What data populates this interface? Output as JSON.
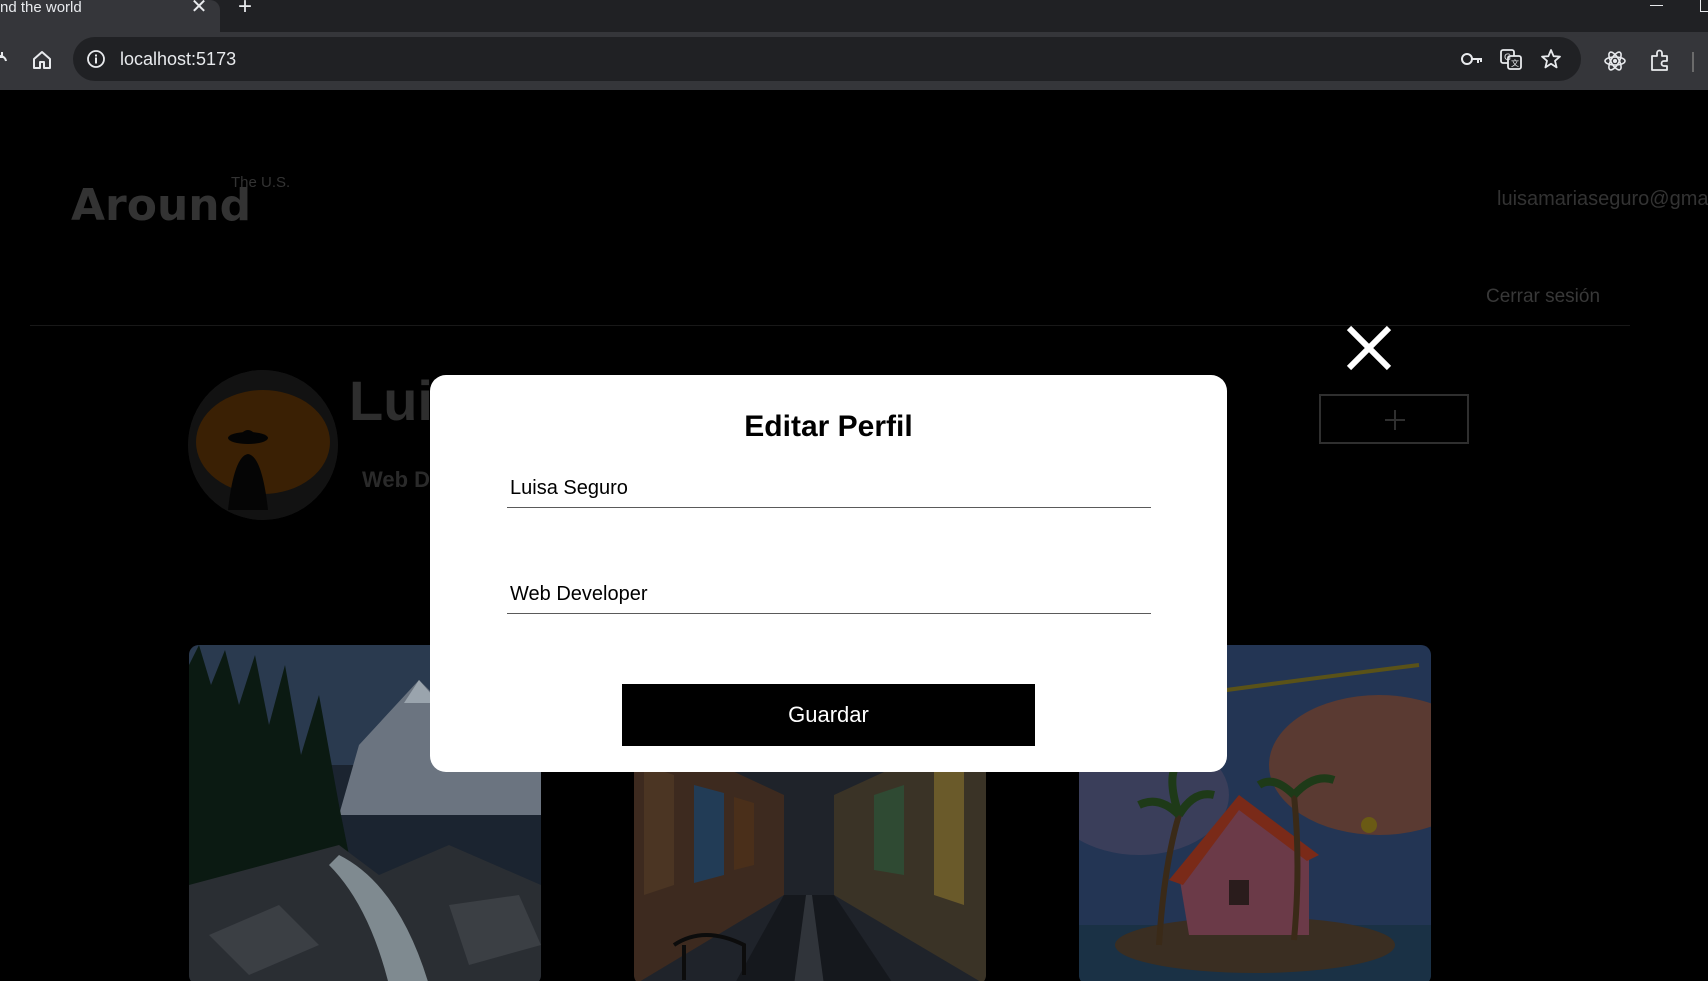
{
  "browser": {
    "tab_title": "nd the world",
    "tab_close": "✕",
    "new_tab": "+",
    "url": "localhost:5173"
  },
  "header": {
    "logo": "Around",
    "logo_sup": "The U.S.",
    "email": "luisamariaseguro@gmai",
    "logout": "Cerrar sesión"
  },
  "profile": {
    "name": "Luis",
    "about": "Web D"
  },
  "modal": {
    "title": "Editar Perfil",
    "name_value": "Luisa Seguro",
    "about_value": "Web Developer",
    "save_label": "Guardar"
  },
  "colors": {
    "overlay": "#000000",
    "modal_bg": "#ffffff",
    "button_bg": "#000000",
    "avatar_accent": "#8a4a08"
  }
}
